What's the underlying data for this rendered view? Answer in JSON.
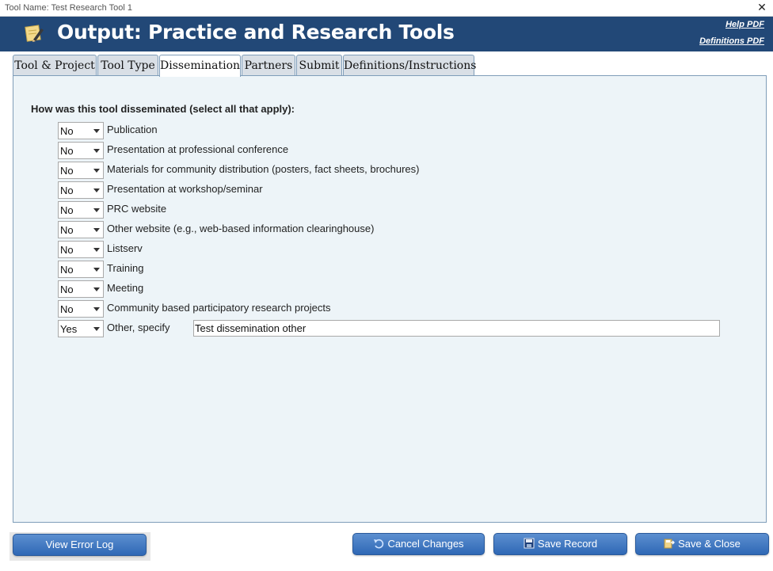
{
  "window": {
    "title": "Tool Name: Test Research Tool 1",
    "close_glyph": "✕"
  },
  "header": {
    "title": "Output: Practice and Research Tools",
    "help_link": "Help PDF",
    "definitions_link": "Definitions PDF",
    "brand_color": "#224877"
  },
  "tabs": [
    {
      "label": "Tool & Project",
      "active": false
    },
    {
      "label": "Tool Type",
      "active": false
    },
    {
      "label": "Dissemination",
      "active": true
    },
    {
      "label": "Partners",
      "active": false
    },
    {
      "label": "Submit",
      "active": false
    },
    {
      "label": "Definitions/Instructions",
      "active": false
    }
  ],
  "form": {
    "question": "How was this tool disseminated (select all that apply):",
    "items": [
      {
        "value": "No",
        "label": "Publication"
      },
      {
        "value": "No",
        "label": "Presentation at professional conference"
      },
      {
        "value": "No",
        "label": "Materials for community distribution (posters, fact sheets, brochures)"
      },
      {
        "value": "No",
        "label": "Presentation at workshop/seminar"
      },
      {
        "value": "No",
        "label": "PRC website"
      },
      {
        "value": "No",
        "label": "Other website (e.g., web-based information clearinghouse)"
      },
      {
        "value": "No",
        "label": "Listserv"
      },
      {
        "value": "No",
        "label": "Training"
      },
      {
        "value": "No",
        "label": "Meeting"
      },
      {
        "value": "No",
        "label": "Community based participatory research projects"
      },
      {
        "value": "Yes",
        "label": "Other, specify"
      }
    ],
    "other_specify_value": "Test dissemination other"
  },
  "buttons": {
    "view_error_log": "View Error Log",
    "cancel_changes": "Cancel Changes",
    "save_record": "Save Record",
    "save_close": "Save & Close"
  },
  "icons": {
    "logo": "note-pencil-icon",
    "cancel": "undo-icon",
    "save": "floppy-disk-icon",
    "save_close": "save-close-icon"
  }
}
